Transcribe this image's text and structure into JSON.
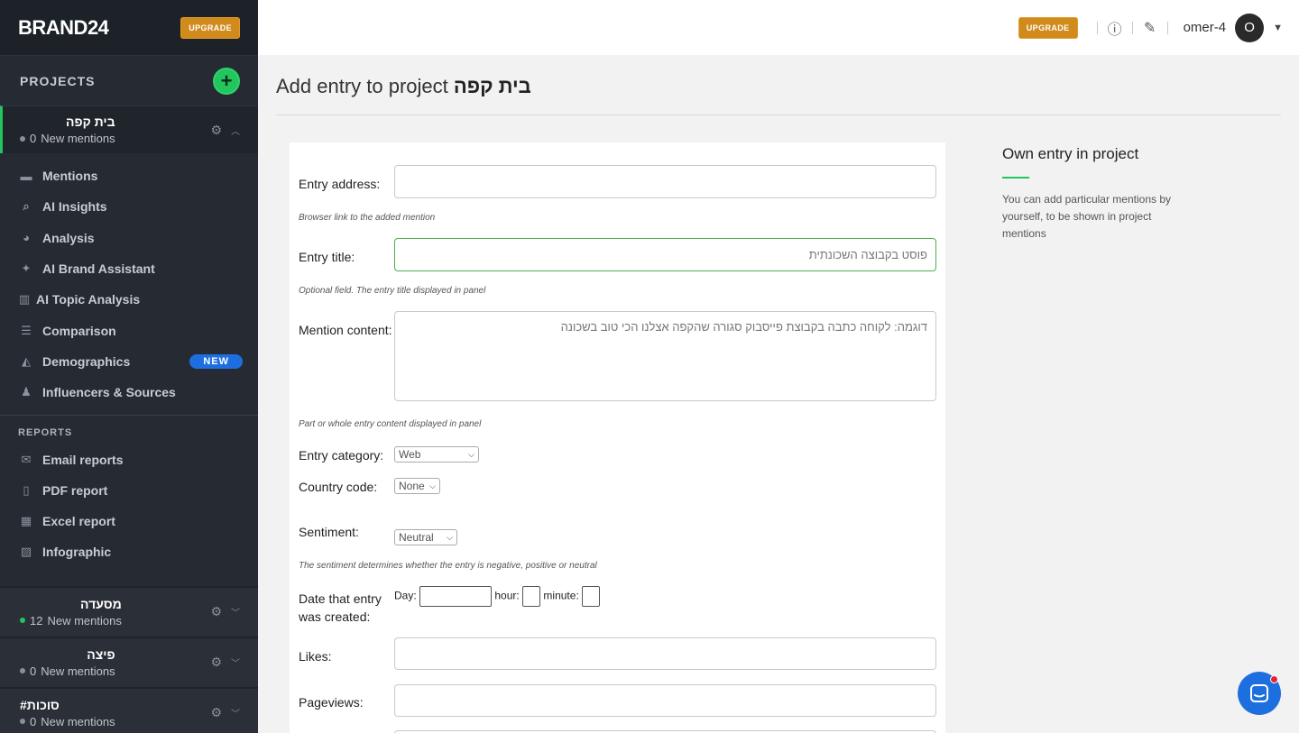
{
  "brand": {
    "logo": "BRAND24",
    "upgrade_label": "UPGRADE"
  },
  "sidebar": {
    "projects_label": "PROJECTS",
    "active_project": {
      "name": "בית קפה",
      "count": "0",
      "mentions_label": "New mentions"
    },
    "nav": [
      {
        "label": "Mentions",
        "icon": "chat-icon"
      },
      {
        "label": "AI Insights",
        "icon": "search-icon"
      },
      {
        "label": "Analysis",
        "icon": "pie-chart-icon"
      },
      {
        "label": "AI Brand Assistant",
        "icon": "sparkle-icon"
      },
      {
        "label": "AI Topic Analysis",
        "icon": "bar-chart-icon"
      },
      {
        "label": "Comparison",
        "icon": "list-icon"
      },
      {
        "label": "Demographics",
        "icon": "area-chart-icon",
        "badge": "NEW"
      },
      {
        "label": "Influencers & Sources",
        "icon": "person-icon"
      }
    ],
    "reports_label": "REPORTS",
    "reports": [
      {
        "label": "Email reports",
        "icon": "envelope-icon"
      },
      {
        "label": "PDF report",
        "icon": "pdf-icon"
      },
      {
        "label": "Excel report",
        "icon": "excel-icon"
      },
      {
        "label": "Infographic",
        "icon": "image-icon"
      }
    ],
    "other_projects": [
      {
        "name": "מסעדה",
        "count": "12",
        "mentions_label": "New mentions",
        "dot": "green"
      },
      {
        "name": "פיצה",
        "count": "0",
        "mentions_label": "New mentions",
        "dot": "grey"
      },
      {
        "name": "#סוכות",
        "count": "0",
        "mentions_label": "New mentions",
        "dot": "grey"
      }
    ]
  },
  "topbar": {
    "upgrade_label": "UPGRADE",
    "username": "omer-4",
    "avatar_initial": "O"
  },
  "page": {
    "title_prefix": "Add entry to project",
    "title_project": "בית קפה"
  },
  "form": {
    "entry_address": {
      "label": "Entry address:",
      "value": "",
      "hint": "Browser link to the added mention"
    },
    "entry_title": {
      "label": "Entry title:",
      "placeholder": "פוסט בקבוצה השכונתית",
      "hint": "Optional field. The entry title displayed in panel"
    },
    "mention_content": {
      "label": "Mention content:",
      "placeholder": "דוגמה: לקוחה כתבה בקבוצת פייסבוק סגורה שהקפה אצלנו הכי טוב בשכונה",
      "hint": "Part or whole entry content displayed in panel"
    },
    "entry_category": {
      "label": "Entry category:",
      "value": "Web"
    },
    "country_code": {
      "label": "Country code:",
      "value": "None"
    },
    "sentiment": {
      "label": "Sentiment:",
      "value": "Neutral",
      "hint": "The sentiment determines whether the entry is negative, positive or neutral"
    },
    "date": {
      "label_line1": "Date that entry",
      "label_line2": "was created:",
      "day_label": "Day:",
      "hour_label": "hour:",
      "minute_label": "minute:"
    },
    "likes": {
      "label": "Likes:"
    },
    "pageviews": {
      "label": "Pageviews:"
    }
  },
  "info": {
    "title": "Own entry in project",
    "text": "You can add particular mentions by yourself, to be shown in project mentions"
  },
  "colors": {
    "accent_green": "#22c55e",
    "upgrade_orange": "#d08b1c",
    "sidebar_bg": "#262b33",
    "chat_blue": "#1d6fe0"
  }
}
